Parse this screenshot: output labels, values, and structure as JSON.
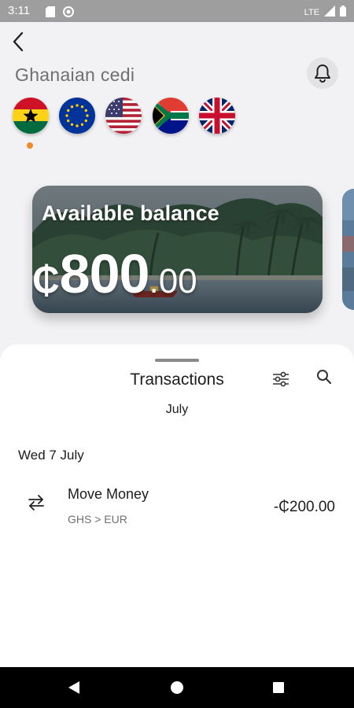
{
  "status_bar": {
    "time": "3:11",
    "network": "LTE"
  },
  "header": {
    "currency_name": "Ghanaian cedi"
  },
  "flags": [
    {
      "name": "flag-ghana-icon",
      "selected": true
    },
    {
      "name": "flag-eu-icon",
      "selected": false
    },
    {
      "name": "flag-usa-icon",
      "selected": false
    },
    {
      "name": "flag-south-africa-icon",
      "selected": false
    },
    {
      "name": "flag-uk-icon",
      "selected": false
    }
  ],
  "balance_card": {
    "label": "Available balance",
    "currency_symbol": "₵",
    "amount_whole": "800",
    "amount_decimal": ".00"
  },
  "transactions": {
    "title": "Transactions",
    "month": "July",
    "groups": [
      {
        "date": "Wed 7 July",
        "items": [
          {
            "name": "Move Money",
            "detail": "GHS > EUR",
            "amount": "-₵200.00",
            "icon": "transfer-arrows-icon"
          }
        ]
      }
    ]
  },
  "colors": {
    "accent_dot": "#f08a2c",
    "sheet_bg": "#ffffff",
    "page_bg": "#f2f2f4"
  }
}
